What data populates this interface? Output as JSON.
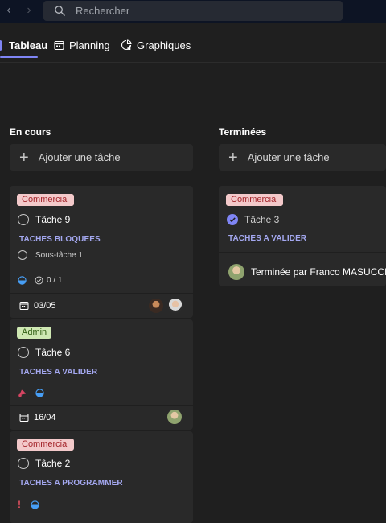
{
  "search": {
    "placeholder": "Rechercher"
  },
  "tabs": [
    {
      "label": "Tableau"
    },
    {
      "label": "Planning"
    },
    {
      "label": "Graphiques"
    }
  ],
  "columns": [
    {
      "title": "En cours",
      "add_label": "Ajouter une tâche",
      "cards": [
        {
          "label": "Commercial",
          "task": "Tâche 9",
          "bucket": "TACHES BLOQUEES",
          "subtask": "Sous-tâche 1",
          "checklist": "0 / 1",
          "date": "03/05"
        },
        {
          "label": "Admin",
          "task": "Tâche 6",
          "bucket": "TACHES A VALIDER",
          "date": "16/04"
        },
        {
          "label": "Commercial",
          "task": "Tâche 2",
          "bucket": "TACHES A PROGRAMMER"
        }
      ]
    },
    {
      "title": "Terminées",
      "add_label": "Ajouter une tâche",
      "cards": [
        {
          "label": "Commercial",
          "task": "Tâche 3",
          "bucket": "TACHES A VALIDER",
          "completed_by": "Terminée par Franco MASUCCI le..."
        }
      ]
    }
  ],
  "colors": {
    "accent": "#7f85f5",
    "commercial_bg": "#f3c9ca",
    "commercial_fg": "#a4262c",
    "admin_bg": "#cfe8b3",
    "admin_fg": "#2f5d11",
    "urgent": "#e04f5f",
    "progress": "#479ef5"
  }
}
